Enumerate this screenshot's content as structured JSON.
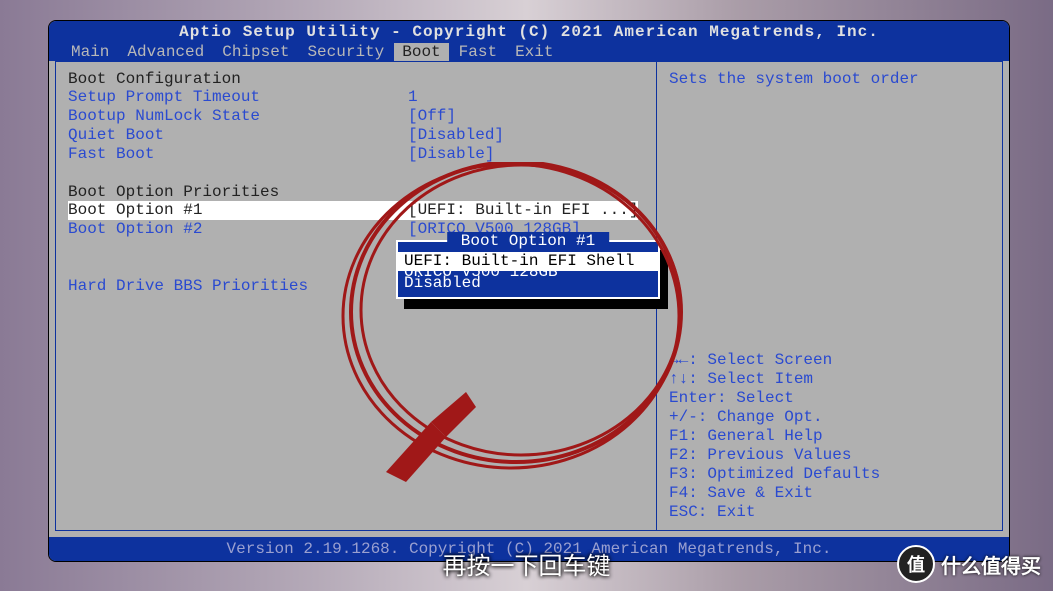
{
  "title": "Aptio Setup Utility - Copyright (C) 2021 American Megatrends, Inc.",
  "menubar": {
    "items": [
      "Main",
      "Advanced",
      "Chipset",
      "Security",
      "Boot",
      "Fast",
      "Exit"
    ],
    "active": "Boot"
  },
  "left": {
    "section1_heading": "Boot Configuration",
    "rows": [
      {
        "label": "Setup Prompt Timeout",
        "value": "1"
      },
      {
        "label": "Bootup NumLock State",
        "value": "[Off]"
      },
      {
        "label": "Quiet Boot",
        "value": "[Disabled]"
      },
      {
        "label": "Fast Boot",
        "value": "[Disable]"
      }
    ],
    "section2_heading": "Boot Option Priorities",
    "boot_opts": [
      {
        "label": "Boot Option #1",
        "value": "[UEFI: Built-in EFI ...]"
      },
      {
        "label": "Boot Option #2",
        "value": "[ORICO V500 128GB]"
      }
    ],
    "submenu": "Hard Drive BBS Priorities"
  },
  "popup": {
    "title": " Boot Option #1 ",
    "items": [
      "UEFI: Built-in EFI Shell",
      "ORICO V500 128GB",
      "Disabled"
    ],
    "selected_index": 0
  },
  "right": {
    "description": "Sets the system boot order",
    "help": [
      "→←: Select Screen",
      "↑↓: Select Item",
      "Enter: Select",
      "+/-: Change Opt.",
      "F1: General Help",
      "F2: Previous Values",
      "F3: Optimized Defaults",
      "F4: Save & Exit",
      "ESC: Exit"
    ]
  },
  "bottom": "Version 2.19.1268. Copyright (C) 2021 American Megatrends, Inc.",
  "subtitle": "再按一下回车键",
  "watermark": {
    "badge": "值",
    "text": "什么值得买"
  }
}
